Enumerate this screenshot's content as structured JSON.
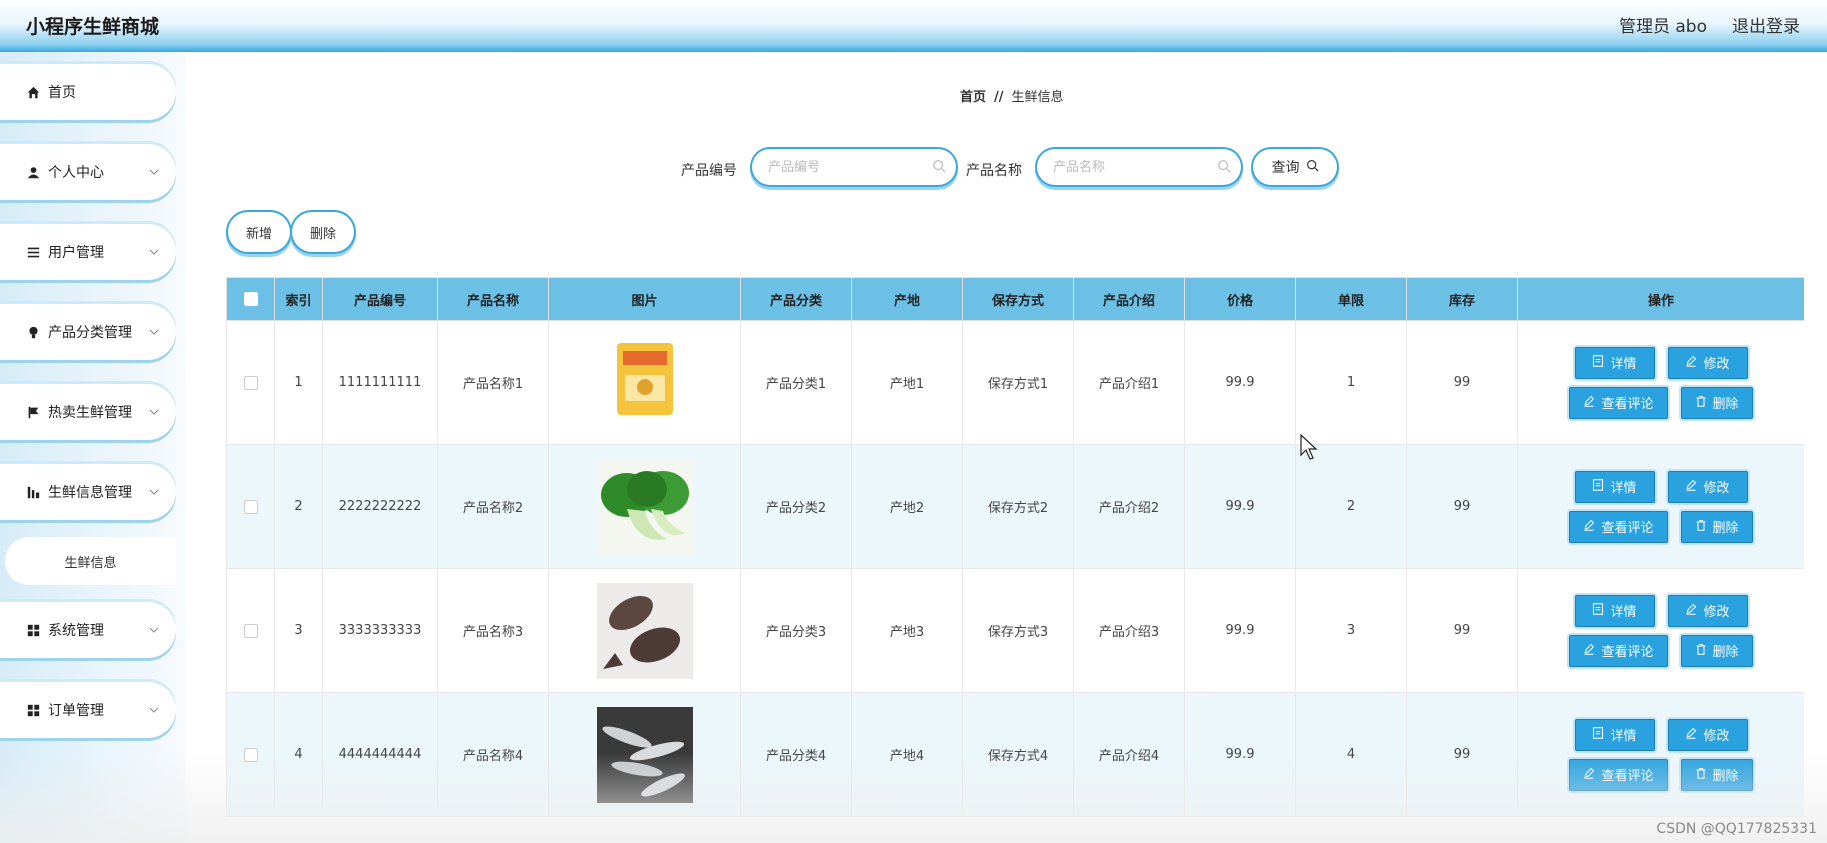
{
  "header": {
    "app_title": "小程序生鲜商城",
    "admin_label": "管理员 abo",
    "logout": "退出登录"
  },
  "sidebar": {
    "items": [
      {
        "label": "首页",
        "icon": "home-icon",
        "has_arrow": false
      },
      {
        "label": "个人中心",
        "icon": "user-icon",
        "has_arrow": true
      },
      {
        "label": "用户管理",
        "icon": "list-icon",
        "has_arrow": true
      },
      {
        "label": "产品分类管理",
        "icon": "bulb-icon",
        "has_arrow": true
      },
      {
        "label": "热卖生鲜管理",
        "icon": "flag-icon",
        "has_arrow": true
      },
      {
        "label": "生鲜信息管理",
        "icon": "chart-icon",
        "has_arrow": true
      },
      {
        "label": "系统管理",
        "icon": "grid-icon",
        "has_arrow": true
      },
      {
        "label": "订单管理",
        "icon": "grid-icon",
        "has_arrow": true
      }
    ],
    "sub_item": "生鲜信息"
  },
  "breadcrumb": {
    "home": "首页",
    "separator": "//",
    "current": "生鲜信息"
  },
  "search": {
    "code_label": "产品编号",
    "code_placeholder": "产品编号",
    "name_label": "产品名称",
    "name_placeholder": "产品名称",
    "query_button": "查询"
  },
  "actions": {
    "add": "新增",
    "delete": "删除"
  },
  "table": {
    "columns": [
      "索引",
      "产品编号",
      "产品名称",
      "图片",
      "产品分类",
      "产地",
      "保存方式",
      "产品介绍",
      "价格",
      "单限",
      "库存",
      "操作"
    ],
    "rows": [
      {
        "index": "1",
        "code": "1111111111",
        "name": "产品名称1",
        "image": "packaged-food",
        "category": "产品分类1",
        "origin": "产地1",
        "storage": "保存方式1",
        "intro": "产品介绍1",
        "price": "99.9",
        "limit": "1",
        "stock": "99"
      },
      {
        "index": "2",
        "code": "2222222222",
        "name": "产品名称2",
        "image": "bok-choy",
        "category": "产品分类2",
        "origin": "产地2",
        "storage": "保存方式2",
        "intro": "产品介绍2",
        "price": "99.9",
        "limit": "2",
        "stock": "99"
      },
      {
        "index": "3",
        "code": "3333333333",
        "name": "产品名称3",
        "image": "flatfish",
        "category": "产品分类3",
        "origin": "产地3",
        "storage": "保存方式3",
        "intro": "产品介绍3",
        "price": "99.9",
        "limit": "3",
        "stock": "99"
      },
      {
        "index": "4",
        "code": "4444444444",
        "name": "产品名称4",
        "image": "small-fish",
        "category": "产品分类4",
        "origin": "产地4",
        "storage": "保存方式4",
        "intro": "产品介绍4",
        "price": "99.9",
        "limit": "4",
        "stock": "99"
      }
    ],
    "row_actions": {
      "detail": "详情",
      "edit": "修改",
      "comments": "查看评论",
      "delete": "删除"
    }
  },
  "watermark": "CSDN @QQ177825331",
  "colors": {
    "accent": "#29a2df",
    "header_bg": "#6cc0e6",
    "row_alt": "#ecf7fc"
  }
}
